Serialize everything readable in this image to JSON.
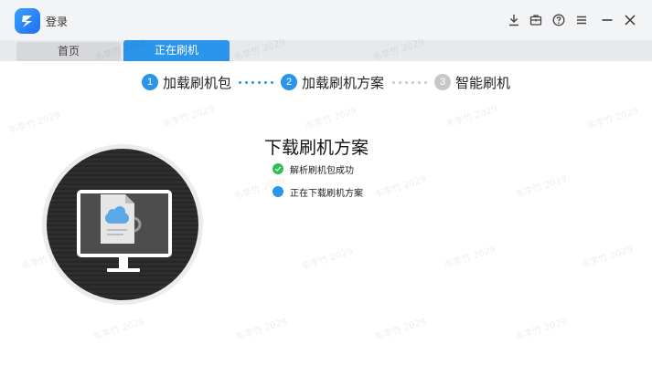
{
  "app": {
    "title": "登录"
  },
  "tabs": [
    {
      "label": "首页",
      "active": false
    },
    {
      "label": "正在刷机",
      "active": true
    }
  ],
  "steps": [
    {
      "number": "1",
      "label": "加载刷机包",
      "state": "active"
    },
    {
      "number": "2",
      "label": "加载刷机方案",
      "state": "active"
    },
    {
      "number": "3",
      "label": "智能刷机",
      "state": "inactive"
    }
  ],
  "status": {
    "title": "下载刷机方案",
    "items": [
      {
        "text": "解析刷机包成功",
        "state": "success",
        "icon": "check-circle-icon"
      },
      {
        "text": "正在下载刷机方案",
        "state": "in-progress",
        "icon": "progress-dot-icon"
      }
    ]
  },
  "watermark": {
    "text": "韦李竹 2029"
  },
  "colors": {
    "accent": "#2b95ec",
    "success": "#2fbf4f",
    "inactive": "#c8c8c8",
    "titlebar": "#f3f4f6"
  },
  "window_controls": [
    "download-icon",
    "toolbox-icon",
    "help-icon",
    "menu-icon",
    "minimize-icon",
    "close-icon"
  ]
}
